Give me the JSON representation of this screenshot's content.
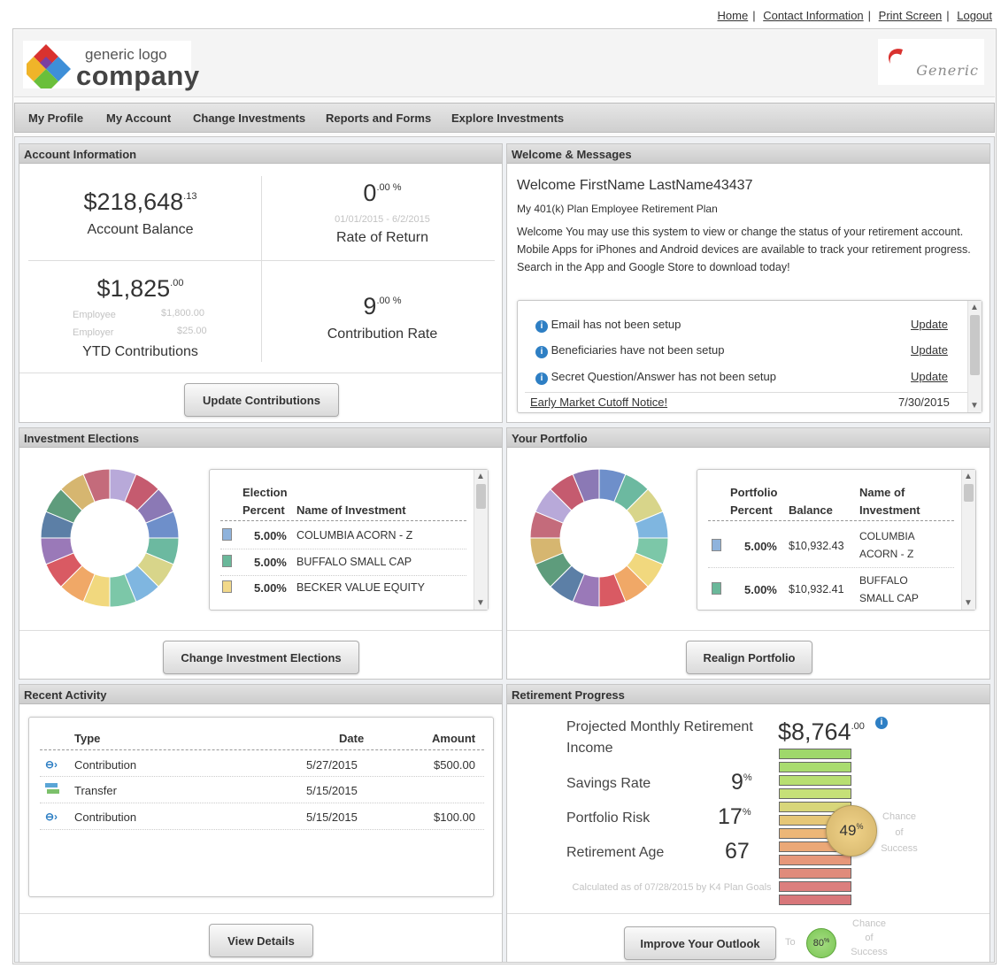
{
  "top_links": [
    "Home",
    "Contact Information",
    "Print Screen",
    "Logout"
  ],
  "logo": {
    "line1": "generic logo",
    "line2": "company"
  },
  "brand": "Generic",
  "nav": [
    "My Profile",
    "My Account",
    "Change Investments",
    "Reports and Forms",
    "Explore Investments"
  ],
  "account": {
    "title": "Account Information",
    "balance_main": "$218,648",
    "balance_cents": ".13",
    "balance_label": "Account Balance",
    "ror_main": "0",
    "ror_sup": ".00 %",
    "ror_dates": "01/01/2015 - 6/2/2015",
    "ror_label": "Rate of Return",
    "ytd_main": "$1,825",
    "ytd_cents": ".00",
    "employee_label": "Employee",
    "employee_val": "$1,800.00",
    "employer_label": "Employer",
    "employer_val": "$25.00",
    "ytd_label": "YTD Contributions",
    "contrib_main": "9",
    "contrib_sup": ".00 %",
    "contrib_label": "Contribution Rate",
    "button": "Update Contributions"
  },
  "welcome": {
    "title": "Welcome & Messages",
    "greeting": "Welcome FirstName LastName43437",
    "plan": "My 401(k) Plan Employee Retirement Plan",
    "body": "Welcome You may use this system to view or change the status of your retirement account. Mobile Apps for iPhones and Android devices are available to track your retirement progress. Search in the App and Google Store to download today!",
    "messages": [
      {
        "text": "Email has not been setup",
        "action": "Update"
      },
      {
        "text": "Beneficiaries have not been setup",
        "action": "Update"
      },
      {
        "text": "Secret Question/Answer has not been setup",
        "action": "Update"
      }
    ],
    "notice": {
      "text": "Early Market Cutoff Notice!",
      "date": "7/30/2015"
    }
  },
  "elections": {
    "title": "Investment Elections",
    "col1a": "Election",
    "col1b": "Percent",
    "col2": "Name of Investment",
    "rows": [
      {
        "pct": "5.00%",
        "name": "COLUMBIA ACORN - Z",
        "color": "#8fb3dc"
      },
      {
        "pct": "5.00%",
        "name": "BUFFALO SMALL CAP",
        "color": "#6ab89a"
      },
      {
        "pct": "5.00%",
        "name": "BECKER VALUE EQUITY",
        "color": "#f2d98a"
      }
    ],
    "button": "Change Investment Elections"
  },
  "portfolio": {
    "title": "Your Portfolio",
    "col1a": "Portfolio",
    "col1b": "Percent",
    "col2": "Balance",
    "col3a": "Name of",
    "col3b": "Investment",
    "rows": [
      {
        "pct": "5.00%",
        "bal": "$10,932.43",
        "name1": "COLUMBIA",
        "name2": "ACORN - Z",
        "color": "#8fb3dc"
      },
      {
        "pct": "5.00%",
        "bal": "$10,932.41",
        "name1": "BUFFALO",
        "name2": "SMALL CAP",
        "color": "#6ab89a"
      }
    ],
    "button": "Realign Portfolio"
  },
  "activity": {
    "title": "Recent Activity",
    "headers": {
      "type": "Type",
      "date": "Date",
      "amount": "Amount"
    },
    "rows": [
      {
        "type": "Contribution",
        "date": "5/27/2015",
        "amount": "$500.00",
        "icon": "contribution-icon"
      },
      {
        "type": "Transfer",
        "date": "5/15/2015",
        "amount": "",
        "icon": "transfer-icon"
      },
      {
        "type": "Contribution",
        "date": "5/15/2015",
        "amount": "$100.00",
        "icon": "contribution-icon"
      }
    ],
    "button": "View Details"
  },
  "retirement": {
    "title": "Retirement Progress",
    "projected_label": "Projected Monthly Retirement Income",
    "projected_main": "$8,764",
    "projected_cents": ".00",
    "savings_label": "Savings Rate",
    "savings_val": "9",
    "savings_sup": "%",
    "risk_label": "Portfolio Risk",
    "risk_val": "17",
    "risk_sup": "%",
    "age_label": "Retirement Age",
    "age_val": "67",
    "calc_note": "Calculated as of 07/28/2015 by K4 Plan Goals",
    "chance_pct": "49",
    "chance_sup": "%",
    "chance_label": "Chance of Success",
    "to_label": "To",
    "improve_pct": "80",
    "improve_sup": "%",
    "button": "Improve Your Outlook"
  },
  "colors": {
    "donut": [
      "#b8a9d9",
      "#c55b6f",
      "#8b79b5",
      "#6e8fca",
      "#6cb9a0",
      "#d8d58a",
      "#7fb6e0",
      "#7cc7a8",
      "#f1d87e",
      "#f0a867",
      "#d95a63",
      "#9a79b8",
      "#5c7fa6",
      "#5e9c7c",
      "#d6b670",
      "#c46b7b"
    ],
    "meter": [
      "#9fd86b",
      "#a9dc6f",
      "#b8df72",
      "#c6e078",
      "#d8d67a",
      "#e6c777",
      "#ecb677",
      "#eba877",
      "#e6977a",
      "#e08b7b",
      "#dc7f7e",
      "#d8777a"
    ]
  }
}
